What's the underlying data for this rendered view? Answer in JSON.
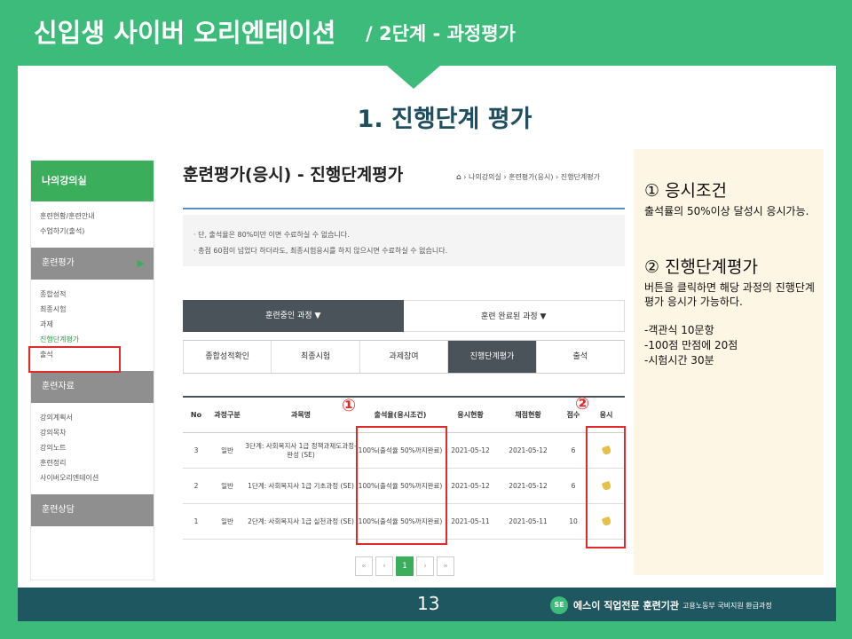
{
  "header": {
    "main_title": "신입생 사이버 오리엔테이션",
    "sub_title": "/ 2단계 - 과정평가"
  },
  "section_title": "1. 진행단계 평가",
  "sidebar": {
    "head": "나의강의실",
    "group1_items": [
      "훈련현황/훈련안내",
      "수업하기(출석)"
    ],
    "group2": "훈련평가",
    "group2_items": [
      "종합성적",
      "최종시험",
      "과제",
      "진행단계평가",
      "출석"
    ],
    "group3": "훈련자료",
    "group3_items": [
      "강의계획서",
      "강의목차",
      "강의노트",
      "훈련정리",
      "사이버오리엔테이션"
    ],
    "group4": "훈련상담"
  },
  "content": {
    "title": "훈련평가(응시) - 진행단계평가",
    "breadcrumb": "› 나의강의실 › 훈련평가(응시) › 진행단계평가",
    "notice": [
      "· 단, 출석율은 80%미만 이면 수료하실 수 없습니다.",
      "· 총점 60점이 넘었다 하더라도, 최종시험응시를 하지 않으시면 수료하실 수 없습니다."
    ],
    "course_tabs": [
      "훈련중인 과정 ▼",
      "훈련 완료된 과정 ▼"
    ],
    "sub_tabs": [
      "종합성적확인",
      "최종시험",
      "과제참여",
      "진행단계평가",
      "출석"
    ],
    "table": {
      "headers": [
        "No",
        "과정구분",
        "과목명",
        "출석율(응시조건)",
        "응시현황",
        "채점현황",
        "점수",
        "응시"
      ],
      "rows": [
        {
          "no": "3",
          "type": "일반",
          "subject": "3단계: 사회복지사 1급 정책과제도과정-완성 (SE)",
          "att": "100%(출석율 50%까지완료)",
          "exam": "2021-05-12",
          "grade": "2021-05-12",
          "score": "6"
        },
        {
          "no": "2",
          "type": "일반",
          "subject": "1단계: 사회복지사 1급 기초과정 (SE)",
          "att": "100%(출석율 50%까지완료)",
          "exam": "2021-05-12",
          "grade": "2021-05-12",
          "score": "6"
        },
        {
          "no": "1",
          "type": "일반",
          "subject": "2단계: 사회복지사 1급 실천과정 (SE)",
          "att": "100%(출석율 50%까지완료)",
          "exam": "2021-05-11",
          "grade": "2021-05-11",
          "score": "10"
        }
      ]
    },
    "pager": [
      "«",
      "‹",
      "1",
      "›",
      "»"
    ],
    "markers": [
      "①",
      "②"
    ]
  },
  "info": {
    "h1": "① 응시조건",
    "p1": "출석률의 50%이상 달성시 응시가능.",
    "h2": "② 진행단계평가",
    "p2": "버튼을 클릭하면 해당 과정의 진행단계평가 응시가 가능하다.",
    "list": [
      "-객관식 10문항",
      "-100점 만점에 20점",
      "-시험시간 30분"
    ]
  },
  "footer": {
    "page": "13",
    "logo": "SE",
    "org": "에스이 직업전문 훈련기관",
    "org_sub": "고용노동부 국비지원 환급과정"
  }
}
